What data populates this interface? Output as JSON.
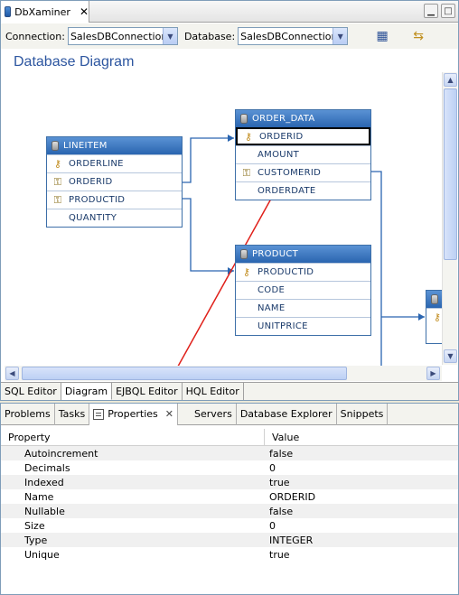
{
  "window": {
    "title": "DbXaminer",
    "close": "✕"
  },
  "toolbar": {
    "connection_label": "Connection:",
    "connection_value": "SalesDBConnection",
    "database_label": "Database:",
    "database_value": "SalesDBConnection"
  },
  "diagram": {
    "title": "Database Diagram",
    "entities": {
      "lineitem": {
        "name": "LINEITEM",
        "rows": [
          "ORDERLINE",
          "ORDERID",
          "PRODUCTID",
          "QUANTITY"
        ]
      },
      "order_data": {
        "name": "ORDER_DATA",
        "rows": [
          "ORDERID",
          "AMOUNT",
          "CUSTOMERID",
          "ORDERDATE"
        ]
      },
      "product": {
        "name": "PRODUCT",
        "rows": [
          "PRODUCTID",
          "CODE",
          "NAME",
          "UNITPRICE"
        ]
      }
    }
  },
  "editor_tabs": [
    "SQL Editor",
    "Diagram",
    "EJBQL Editor",
    "HQL Editor"
  ],
  "view_tabs": [
    "Problems",
    "Tasks",
    "Properties",
    "Servers",
    "Database Explorer",
    "Snippets"
  ],
  "properties": {
    "header": {
      "property": "Property",
      "value": "Value"
    },
    "rows": [
      {
        "name": "Autoincrement",
        "value": "false"
      },
      {
        "name": "Decimals",
        "value": "0"
      },
      {
        "name": "Indexed",
        "value": "true"
      },
      {
        "name": "Name",
        "value": "ORDERID"
      },
      {
        "name": "Nullable",
        "value": "false"
      },
      {
        "name": "Size",
        "value": "0"
      },
      {
        "name": "Type",
        "value": "INTEGER"
      },
      {
        "name": "Unique",
        "value": "true"
      }
    ]
  },
  "colors": {
    "accent": "#2a65b0",
    "arrow": "#e0201a",
    "title": "#2d56a0"
  }
}
